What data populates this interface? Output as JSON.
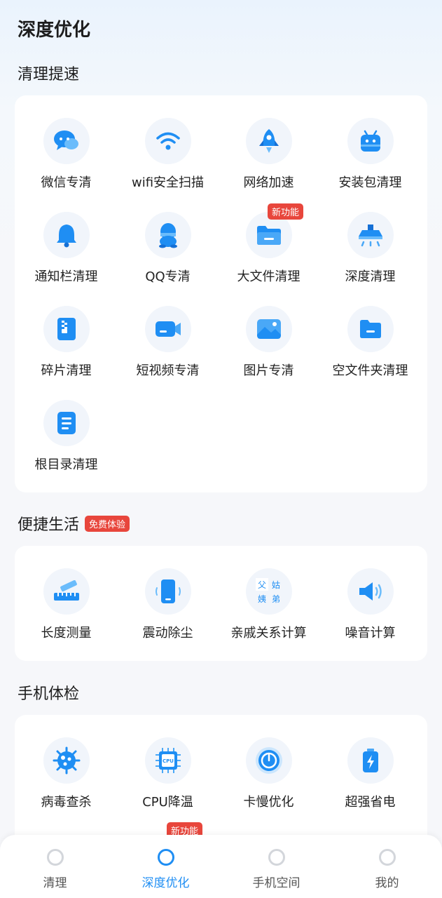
{
  "page_title": "深度优化",
  "sections": {
    "clean": {
      "title": "清理提速",
      "items": [
        {
          "label": "微信专清",
          "icon": "wechat-icon"
        },
        {
          "label": "wifi安全扫描",
          "icon": "wifi-icon"
        },
        {
          "label": "网络加速",
          "icon": "rocket-icon"
        },
        {
          "label": "安装包清理",
          "icon": "android-icon"
        },
        {
          "label": "通知栏清理",
          "icon": "bell-icon"
        },
        {
          "label": "QQ专清",
          "icon": "qq-icon"
        },
        {
          "label": "大文件清理",
          "icon": "folder-icon",
          "badge": "新功能"
        },
        {
          "label": "深度清理",
          "icon": "range-hood-icon"
        },
        {
          "label": "碎片清理",
          "icon": "zip-file-icon"
        },
        {
          "label": "短视频专清",
          "icon": "video-camera-icon"
        },
        {
          "label": "图片专清",
          "icon": "image-icon"
        },
        {
          "label": "空文件夹清理",
          "icon": "empty-folder-icon"
        },
        {
          "label": "根目录清理",
          "icon": "document-list-icon"
        }
      ]
    },
    "life": {
      "title": "便捷生活",
      "badge": "免费体验",
      "items": [
        {
          "label": "长度测量",
          "icon": "ruler-icon"
        },
        {
          "label": "震动除尘",
          "icon": "vibrating-phone-icon"
        },
        {
          "label": "亲戚关系计算",
          "icon": "relatives-grid-icon",
          "glyphs": [
            "父",
            "姑",
            "姨",
            "弟"
          ]
        },
        {
          "label": "噪音计算",
          "icon": "speaker-icon"
        }
      ]
    },
    "check": {
      "title": "手机体检",
      "items": [
        {
          "label": "病毒查杀",
          "icon": "virus-icon"
        },
        {
          "label": "CPU降温",
          "icon": "cpu-icon",
          "chip_text": "CPU"
        },
        {
          "label": "卡慢优化",
          "icon": "speed-gauge-icon"
        },
        {
          "label": "超强省电",
          "icon": "battery-icon"
        }
      ],
      "overflow_badge": "新功能"
    }
  },
  "tabbar": {
    "tabs": [
      {
        "label": "清理",
        "active": false
      },
      {
        "label": "深度优化",
        "active": true
      },
      {
        "label": "手机空间",
        "active": false
      },
      {
        "label": "我的",
        "active": false
      }
    ]
  },
  "colors": {
    "accent": "#1f8ef3",
    "badge": "#e8463c"
  }
}
